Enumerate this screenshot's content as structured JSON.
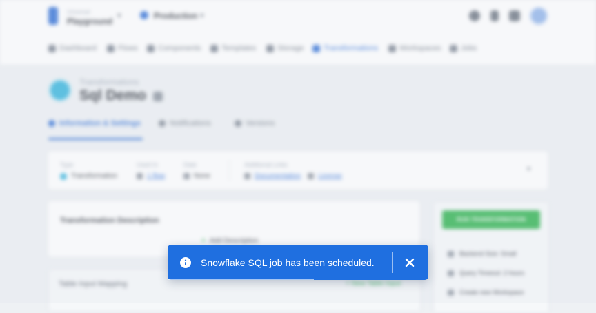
{
  "header": {
    "project_label": "Universal",
    "project_name": "Playground",
    "environment": "Production"
  },
  "nav": {
    "items": [
      {
        "label": "Dashboard",
        "active": false
      },
      {
        "label": "Flows",
        "active": false
      },
      {
        "label": "Components",
        "active": false
      },
      {
        "label": "Templates",
        "active": false
      },
      {
        "label": "Storage",
        "active": false
      },
      {
        "label": "Transformations",
        "active": true
      },
      {
        "label": "Workspaces",
        "active": false
      },
      {
        "label": "Jobs",
        "active": false
      }
    ]
  },
  "page": {
    "breadcrumb": "Transformations",
    "title": "Sql Demo"
  },
  "tabs": [
    {
      "label": "Information & Settings",
      "active": true
    },
    {
      "label": "Notifications",
      "active": false
    },
    {
      "label": "Versions",
      "active": false
    }
  ],
  "info": {
    "type_label": "Type",
    "type_value": "Transformation",
    "used_in_label": "Used In",
    "used_in_value": "1 flow",
    "date_label": "Date",
    "date_value": "None",
    "links_label": "Additional Links",
    "doc_link": "Documentation",
    "license_link": "License"
  },
  "description": {
    "title": "Transformation Description",
    "add_label": "Add Description"
  },
  "input_mapping": {
    "title": "Table Input Mapping",
    "add_label": "New Table Input"
  },
  "side": {
    "run_button": "RUN TRANSFORMATION",
    "backend_size": "Backend Size: Small",
    "query_timeout": "Query Timeout: 2 hours",
    "create_workspace": "Create new Workspace"
  },
  "toast": {
    "link_text": "Snowflake SQL job",
    "message": " has been scheduled.",
    "progress": 0.56
  },
  "colors": {
    "toast_bg": "#1f6fe0",
    "accent": "#2f6fd6",
    "success": "#2bb24c"
  }
}
